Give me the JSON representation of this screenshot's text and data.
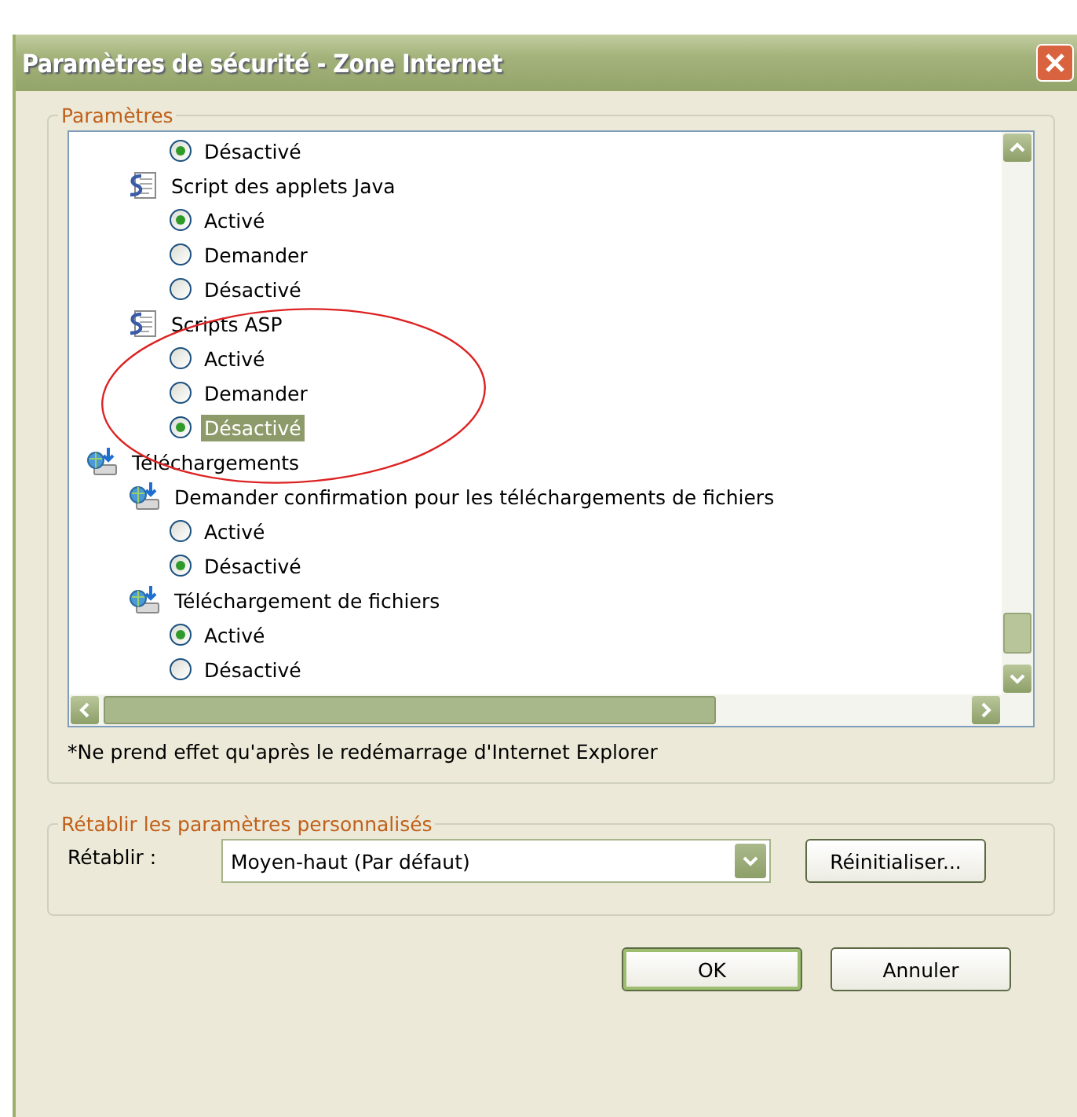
{
  "window": {
    "title": "Paramètres de sécurité - Zone Internet"
  },
  "settings": {
    "title": "Paramètres",
    "tree": [
      {
        "children": [
          {
            "children": [
              {
                "kind": "radio",
                "label": "Désactivé",
                "selected": true,
                "focused": false
              }
            ]
          },
          {
            "kind": "script",
            "label": "Script des applets Java",
            "children": [
              {
                "kind": "radio",
                "label": "Activé",
                "selected": true,
                "focused": false
              },
              {
                "kind": "radio",
                "label": "Demander",
                "selected": false,
                "focused": false
              },
              {
                "kind": "radio",
                "label": "Désactivé",
                "selected": false,
                "focused": false
              }
            ]
          },
          {
            "kind": "script",
            "label": "Scripts ASP",
            "children": [
              {
                "kind": "radio",
                "label": "Activé",
                "selected": false,
                "focused": false
              },
              {
                "kind": "radio",
                "label": "Demander",
                "selected": false,
                "focused": false
              },
              {
                "kind": "radio",
                "label": "Désactivé",
                "selected": true,
                "focused": true
              }
            ]
          }
        ]
      },
      {
        "kind": "download",
        "label": "Téléchargements",
        "children": [
          {
            "kind": "download",
            "label": "Demander confirmation pour les téléchargements de fichiers",
            "children": [
              {
                "kind": "radio",
                "label": "Activé",
                "selected": false,
                "focused": false
              },
              {
                "kind": "radio",
                "label": "Désactivé",
                "selected": true,
                "focused": false
              }
            ]
          },
          {
            "kind": "download",
            "label": "Téléchargement de fichiers",
            "children": [
              {
                "kind": "radio",
                "label": "Activé",
                "selected": true,
                "focused": false
              },
              {
                "kind": "radio",
                "label": "Désactivé",
                "selected": false,
                "focused": false
              }
            ]
          }
        ]
      }
    ],
    "note": "*Ne prend effet qu'après le redémarrage d'Internet Explorer"
  },
  "reset": {
    "title": "Rétablir les paramètres personnalisés",
    "label": "Rétablir :",
    "dropdown": {
      "value": "Moyen-haut (Par défaut)"
    },
    "button": "Réinitialiser..."
  },
  "buttons": [
    {
      "label": "OK",
      "default": true
    },
    {
      "label": "Annuler",
      "default": false
    }
  ]
}
